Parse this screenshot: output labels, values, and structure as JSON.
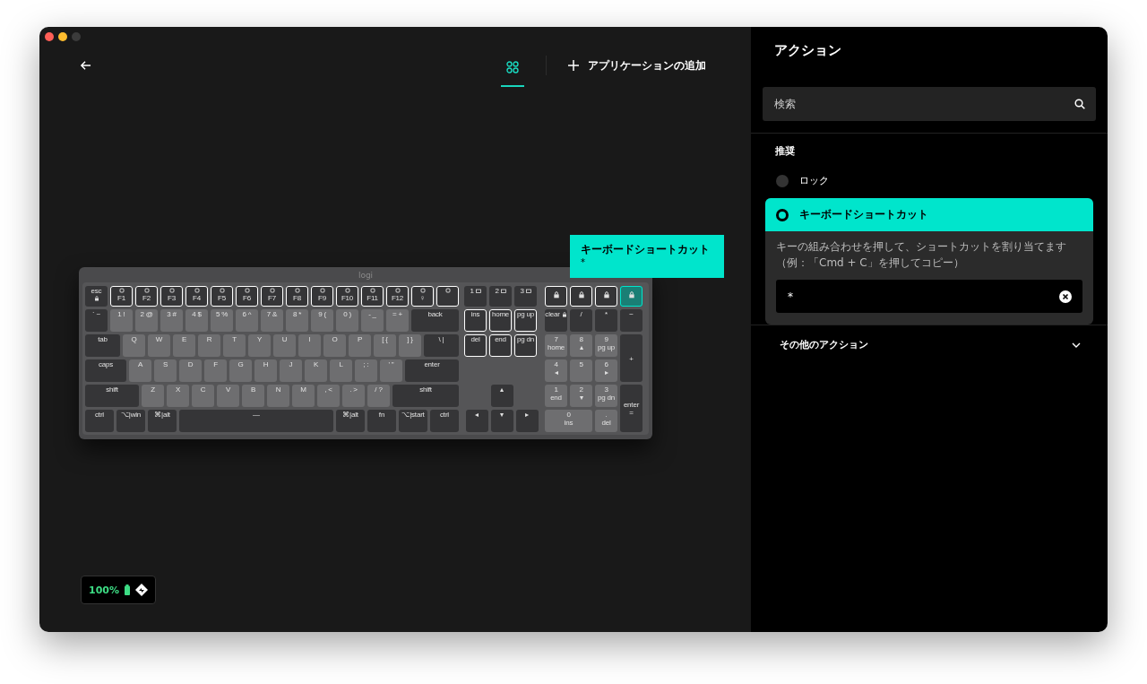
{
  "toolbar": {
    "add_app_label": "アプリケーションの追加"
  },
  "keyboard": {
    "logo": "logi",
    "main": [
      [
        {
          "label": "esc",
          "kind": "esc",
          "highlighted": false,
          "selected": false
        },
        {
          "label": "F1",
          "kind": "fkey",
          "highlighted": true,
          "selected": false
        },
        {
          "label": "F2",
          "kind": "fkey",
          "highlighted": true,
          "selected": false
        },
        {
          "label": "F3",
          "kind": "fkey",
          "highlighted": true,
          "selected": false
        },
        {
          "label": "F4",
          "kind": "fkey",
          "highlighted": true,
          "selected": false
        },
        {
          "label": "F5",
          "kind": "fkey",
          "highlighted": true,
          "selected": false
        },
        {
          "label": "F6",
          "kind": "fkey",
          "highlighted": true,
          "selected": false
        },
        {
          "label": "F7",
          "kind": "fkey",
          "highlighted": true,
          "selected": false
        },
        {
          "label": "F8",
          "kind": "fkey",
          "highlighted": true,
          "selected": false
        },
        {
          "label": "F9",
          "kind": "fkey",
          "highlighted": true,
          "selected": false
        },
        {
          "label": "F10",
          "kind": "fkey",
          "highlighted": true,
          "selected": false
        },
        {
          "label": "F11",
          "kind": "fkey",
          "highlighted": true,
          "selected": false
        },
        {
          "label": "F12",
          "kind": "fkey",
          "highlighted": true,
          "selected": false
        },
        {
          "label": "♀",
          "kind": "fkey",
          "highlighted": true,
          "selected": false
        },
        {
          "kind": "fkey",
          "highlighted": true,
          "selected": false
        }
      ],
      [
        {
          "label": "` ~",
          "kind": "key",
          "highlighted": false,
          "selected": false
        },
        {
          "label": "1 !",
          "kind": "letter",
          "highlighted": false,
          "selected": false
        },
        {
          "label": "2 @",
          "kind": "letter",
          "highlighted": false,
          "selected": false
        },
        {
          "label": "3 #",
          "kind": "letter",
          "highlighted": false,
          "selected": false
        },
        {
          "label": "4 $",
          "kind": "letter",
          "highlighted": false,
          "selected": false
        },
        {
          "label": "5 %",
          "kind": "letter",
          "highlighted": false,
          "selected": false
        },
        {
          "label": "6 ^",
          "kind": "letter",
          "highlighted": false,
          "selected": false
        },
        {
          "label": "7 &",
          "kind": "letter",
          "highlighted": false,
          "selected": false
        },
        {
          "label": "8 *",
          "kind": "letter",
          "highlighted": false,
          "selected": false
        },
        {
          "label": "9 (",
          "kind": "letter",
          "highlighted": false,
          "selected": false
        },
        {
          "label": "0 )",
          "kind": "letter",
          "highlighted": false,
          "selected": false
        },
        {
          "label": "- _",
          "kind": "letter",
          "highlighted": false,
          "selected": false
        },
        {
          "label": "= +",
          "kind": "letter",
          "highlighted": false,
          "selected": false
        },
        {
          "label": "back",
          "kind": "back",
          "highlighted": false,
          "selected": false
        }
      ],
      [
        {
          "label": "tab",
          "kind": "tab",
          "highlighted": false,
          "selected": false
        },
        {
          "label": "Q",
          "kind": "letter",
          "highlighted": false,
          "selected": false
        },
        {
          "label": "W",
          "kind": "letter",
          "highlighted": false,
          "selected": false
        },
        {
          "label": "E",
          "kind": "letter",
          "highlighted": false,
          "selected": false
        },
        {
          "label": "R",
          "kind": "letter",
          "highlighted": false,
          "selected": false
        },
        {
          "label": "T",
          "kind": "letter",
          "highlighted": false,
          "selected": false
        },
        {
          "label": "Y",
          "kind": "letter",
          "highlighted": false,
          "selected": false
        },
        {
          "label": "U",
          "kind": "letter",
          "highlighted": false,
          "selected": false
        },
        {
          "label": "I",
          "kind": "letter",
          "highlighted": false,
          "selected": false
        },
        {
          "label": "O",
          "kind": "letter",
          "highlighted": false,
          "selected": false
        },
        {
          "label": "P",
          "kind": "letter",
          "highlighted": false,
          "selected": false
        },
        {
          "label": "[ {",
          "kind": "letter",
          "highlighted": false,
          "selected": false
        },
        {
          "label": "] }",
          "kind": "letter",
          "highlighted": false,
          "selected": false
        },
        {
          "label": "\\ |",
          "kind": "tab",
          "highlighted": false,
          "selected": false
        }
      ],
      [
        {
          "label": "caps",
          "kind": "caps",
          "highlighted": false,
          "selected": false
        },
        {
          "label": "A",
          "kind": "letter",
          "highlighted": false,
          "selected": false
        },
        {
          "label": "S",
          "kind": "letter",
          "highlighted": false,
          "selected": false
        },
        {
          "label": "D",
          "kind": "letter",
          "highlighted": false,
          "selected": false
        },
        {
          "label": "F",
          "kind": "letter",
          "highlighted": false,
          "selected": false
        },
        {
          "label": "G",
          "kind": "letter",
          "highlighted": false,
          "selected": false
        },
        {
          "label": "H",
          "kind": "letter",
          "highlighted": false,
          "selected": false
        },
        {
          "label": "J",
          "kind": "letter",
          "highlighted": false,
          "selected": false
        },
        {
          "label": "K",
          "kind": "letter",
          "highlighted": false,
          "selected": false
        },
        {
          "label": "L",
          "kind": "letter",
          "highlighted": false,
          "selected": false
        },
        {
          "label": "; :",
          "kind": "letter",
          "highlighted": false,
          "selected": false
        },
        {
          "label": "' \"",
          "kind": "letter",
          "highlighted": false,
          "selected": false
        },
        {
          "label": "enter",
          "kind": "enter",
          "highlighted": false,
          "selected": false
        }
      ],
      [
        {
          "label": "shift",
          "kind": "enter",
          "highlighted": false,
          "selected": false
        },
        {
          "label": "Z",
          "kind": "letter",
          "highlighted": false,
          "selected": false
        },
        {
          "label": "X",
          "kind": "letter",
          "highlighted": false,
          "selected": false
        },
        {
          "label": "C",
          "kind": "letter",
          "highlighted": false,
          "selected": false
        },
        {
          "label": "V",
          "kind": "letter",
          "highlighted": false,
          "selected": false
        },
        {
          "label": "B",
          "kind": "letter",
          "highlighted": false,
          "selected": false
        },
        {
          "label": "N",
          "kind": "letter",
          "highlighted": false,
          "selected": false
        },
        {
          "label": "M",
          "kind": "letter",
          "highlighted": false,
          "selected": false
        },
        {
          "label": ", <",
          "kind": "letter",
          "highlighted": false,
          "selected": false
        },
        {
          "label": ". >",
          "kind": "letter",
          "highlighted": false,
          "selected": false
        },
        {
          "label": "/ ?",
          "kind": "letter",
          "highlighted": false,
          "selected": false
        },
        {
          "label": "shift",
          "kind": "rshift",
          "highlighted": false,
          "selected": false
        }
      ],
      [
        {
          "label": "ctrl",
          "kind": "mod",
          "highlighted": false,
          "selected": false
        },
        {
          "label": "⌥|win",
          "kind": "mod",
          "highlighted": false,
          "selected": false
        },
        {
          "label": "⌘|alt",
          "kind": "mod",
          "highlighted": false,
          "selected": false
        },
        {
          "label": "—",
          "kind": "space",
          "highlighted": false,
          "selected": false
        },
        {
          "label": "⌘|alt",
          "kind": "mod",
          "highlighted": false,
          "selected": false
        },
        {
          "label": "fn",
          "kind": "mod",
          "highlighted": false,
          "selected": false
        },
        {
          "label": "⌥|start",
          "kind": "mod",
          "highlighted": false,
          "selected": false
        },
        {
          "label": "ctrl",
          "kind": "mod",
          "highlighted": false,
          "selected": false
        }
      ]
    ],
    "nav": [
      [
        {
          "label": "1",
          "kind": "device",
          "highlighted": false,
          "selected": false
        },
        {
          "label": "2",
          "kind": "device",
          "highlighted": false,
          "selected": false
        },
        {
          "label": "3",
          "kind": "device",
          "highlighted": false,
          "selected": false
        }
      ],
      [
        {
          "label": "ins",
          "kind": "key",
          "highlighted": true,
          "selected": false
        },
        {
          "label": "home",
          "kind": "key",
          "highlighted": true,
          "selected": false
        },
        {
          "label": "pg up",
          "kind": "key",
          "highlighted": true,
          "selected": false
        }
      ],
      [
        {
          "label": "del",
          "kind": "key",
          "highlighted": true,
          "selected": false
        },
        {
          "label": "end",
          "kind": "key",
          "highlighted": true,
          "selected": false
        },
        {
          "label": "pg dn",
          "kind": "key",
          "highlighted": true,
          "selected": false
        }
      ]
    ],
    "arrows": [
      [
        {
          "label": "▴",
          "kind": "key",
          "highlighted": false,
          "selected": false
        }
      ],
      [
        {
          "label": "◂",
          "kind": "key",
          "highlighted": false,
          "selected": false
        },
        {
          "label": "▾",
          "kind": "key",
          "highlighted": false,
          "selected": false
        },
        {
          "label": "▸",
          "kind": "key",
          "highlighted": false,
          "selected": false
        }
      ]
    ],
    "numpad": [
      {
        "kind": "symbol",
        "highlighted": true,
        "selected": false
      },
      {
        "kind": "symbol",
        "highlighted": true,
        "selected": false
      },
      {
        "kind": "symbol",
        "highlighted": true,
        "selected": false
      },
      {
        "kind": "symbol",
        "highlighted": true,
        "selected": true
      },
      {
        "label": "clear",
        "kind": "clear",
        "highlighted": false,
        "selected": false
      },
      {
        "label": "/",
        "kind": "key",
        "highlighted": false,
        "selected": false
      },
      {
        "label": "*",
        "kind": "key",
        "highlighted": false,
        "selected": false
      },
      {
        "label": "−",
        "kind": "key",
        "highlighted": false,
        "selected": false
      },
      {
        "label": "7",
        "sub": "home",
        "kind": "letter",
        "highlighted": false,
        "selected": false
      },
      {
        "label": "8",
        "sub": "▴",
        "kind": "letter",
        "highlighted": false,
        "selected": false
      },
      {
        "label": "9",
        "sub": "pg up",
        "kind": "letter",
        "highlighted": false,
        "selected": false
      },
      {
        "label": "+",
        "kind": "tall",
        "highlighted": false,
        "selected": false
      },
      {
        "label": "4",
        "sub": "◂",
        "kind": "letter",
        "highlighted": false,
        "selected": false
      },
      {
        "label": "5",
        "kind": "letter",
        "highlighted": false,
        "selected": false
      },
      {
        "label": "6",
        "sub": "▸",
        "kind": "letter",
        "highlighted": false,
        "selected": false
      },
      {
        "label": "1",
        "sub": "end",
        "kind": "letter",
        "highlighted": false,
        "selected": false
      },
      {
        "label": "2",
        "sub": "▾",
        "kind": "letter",
        "highlighted": false,
        "selected": false
      },
      {
        "label": "3",
        "sub": "pg dn",
        "kind": "letter",
        "highlighted": false,
        "selected": false
      },
      {
        "label": "enter",
        "sub": "=",
        "kind": "tall",
        "highlighted": false,
        "selected": false
      },
      {
        "label": "0",
        "sub": "ins",
        "kind": "wide",
        "highlighted": false,
        "selected": false
      },
      {
        "label": ".",
        "sub": "del",
        "kind": "letter",
        "highlighted": false,
        "selected": false
      }
    ]
  },
  "callout": {
    "title": "キーボードショートカット",
    "value": "*"
  },
  "battery": {
    "reading": "100%"
  },
  "actions": {
    "title": "アクション",
    "search": {
      "placeholder": "検索"
    },
    "section": "推奨",
    "options": [
      {
        "label": "ロック",
        "selected": false
      },
      {
        "label": "キーボードショートカット",
        "selected": true,
        "description": "キーの組み合わせを押して、ショートカットを割り当てます（例：「Cmd + C」を押してコピー）",
        "value": "*"
      }
    ],
    "more": {
      "label": "その他のアクション",
      "expanded": false
    }
  }
}
